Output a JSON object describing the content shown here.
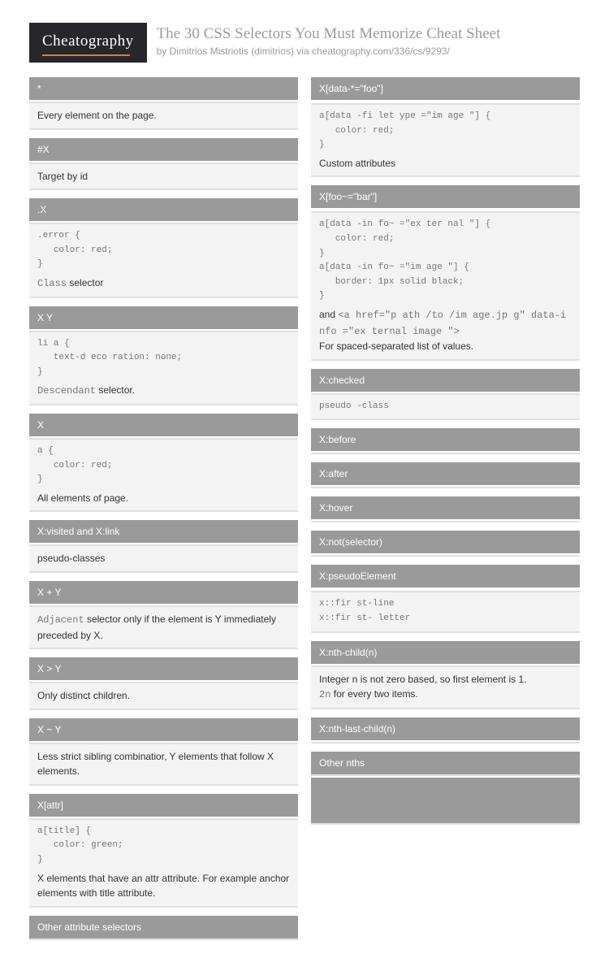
{
  "header": {
    "logo": "Cheatography",
    "title": "The 30 CSS Selectors You Must Memorize Cheat Sheet",
    "by": "by",
    "author": "Dimitrios Mistriotis (dimitrios)",
    "via": "via",
    "url": "cheatography.com/336/cs/9293/"
  },
  "col1": [
    {
      "title": "*",
      "desc": "Every element on the page."
    },
    {
      "title": "#X",
      "desc": "Target by id"
    },
    {
      "title": ".X",
      "code": ".error {\n   color: red;\n}",
      "desc_pre": "Class",
      "desc_post": " selector"
    },
    {
      "title": "X Y",
      "code": "li a {\n   text-d eco ration: none;\n}",
      "desc_pre": "Descendant",
      "desc_post": " selector."
    },
    {
      "title": "X",
      "code": "a {\n   color: red;\n}",
      "desc": "All elements of page."
    },
    {
      "title": "X:visited and X:link",
      "desc": "pseudo-classes"
    },
    {
      "title": "X + Y",
      "desc_pre": "Adjacent",
      "desc_post": " selector only if the element is Y immediately preceded by X."
    },
    {
      "title": "X > Y",
      "desc": "Only distinct children."
    },
    {
      "title": "X ~ Y",
      "desc": "Less strict sibling combinatior, Y elements that follow X elements."
    },
    {
      "title": "X[attr]",
      "code": "a[title] {\n   color: green;\n}",
      "desc": "X elements that have an attr attribute. For example anchor elements with title attribute."
    }
  ],
  "col1_footer": "Other attribute selectors",
  "col2": [
    {
      "title": "X[data-*=\"foo\"]",
      "code": "a[data -fi let ype =\"im age \"] {\n   color: red;\n}",
      "desc": "Custom attributes",
      "spacer": true
    },
    {
      "title": "X[foo~=\"bar\"]",
      "code": "a[data -in fo~ =\"ex ter nal \"] {\n   color: red;\n}\na[data -in fo~ =\"im age \"] {\n   border: 1px solid black;\n}",
      "htmltail_pre": "and ",
      "htmltail_code": "<a href=\"p ath /to /im age.jp g\" data-i nfo =\"ex ternal image \">",
      "desc2": "For spaced-separated list of values.",
      "spacer": true
    },
    {
      "title": "X:checked",
      "mono_desc": "pseudo -class"
    },
    {
      "title": "X:before"
    },
    {
      "title": "X:after"
    },
    {
      "title": "X:hover"
    },
    {
      "title": "X:not(selector)"
    },
    {
      "title": "X:pseudoElement",
      "mono_desc": "x::fir st-line\nx::fir st- letter",
      "spacer": true
    },
    {
      "title": "X:nth-child(n)",
      "desc": "Integer n is not zero based, so first element is 1.",
      "tail_code": "2n",
      "tail_text": " for every two items."
    },
    {
      "title": "X:nth-last-child(n)"
    }
  ],
  "col2_footer": "Other nths"
}
